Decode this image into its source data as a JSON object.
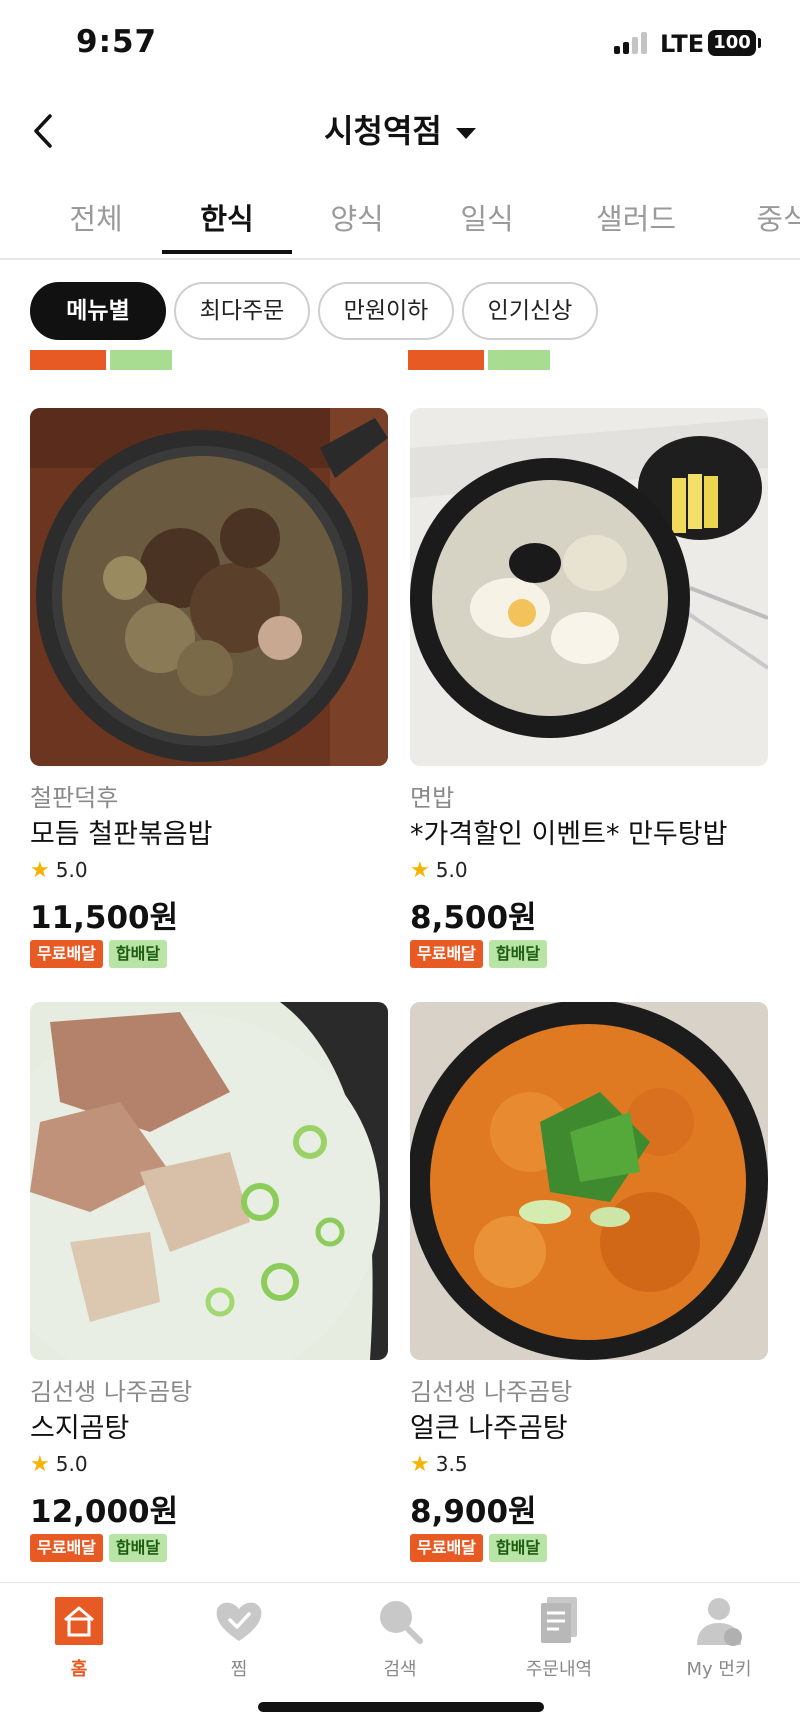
{
  "status_bar": {
    "time": "9:57",
    "network": "LTE",
    "battery": "100"
  },
  "header": {
    "title": "시청역점"
  },
  "tabs": [
    {
      "label": "전체",
      "active": false
    },
    {
      "label": "한식",
      "active": true
    },
    {
      "label": "양식",
      "active": false
    },
    {
      "label": "일식",
      "active": false
    },
    {
      "label": "샐러드",
      "active": false
    },
    {
      "label": "중식",
      "active": false
    }
  ],
  "filters": [
    {
      "label": "메뉴별",
      "active": true
    },
    {
      "label": "최다주문",
      "active": false
    },
    {
      "label": "만원이하",
      "active": false
    },
    {
      "label": "인기신상",
      "active": false
    }
  ],
  "badges": {
    "free_delivery": "무료배달",
    "combined_delivery": "합배달"
  },
  "menu_items": [
    {
      "store": "철판덕후",
      "name": "모듬 철판볶음밥",
      "rating": "5.0",
      "price": "11,500원"
    },
    {
      "store": "면밥",
      "name": "*가격할인 이벤트* 만두탕밥",
      "rating": "5.0",
      "price": "8,500원"
    },
    {
      "store": "김선생 나주곰탕",
      "name": "스지곰탕",
      "rating": "5.0",
      "price": "12,000원"
    },
    {
      "store": "김선생 나주곰탕",
      "name": "얼큰 나주곰탕",
      "rating": "3.5",
      "price": "8,900원"
    }
  ],
  "bottom_nav": [
    {
      "label": "홈",
      "icon": "home-icon",
      "active": true
    },
    {
      "label": "찜",
      "icon": "heart-icon",
      "active": false
    },
    {
      "label": "검색",
      "icon": "search-icon",
      "active": false
    },
    {
      "label": "주문내역",
      "icon": "receipt-icon",
      "active": false
    },
    {
      "label": "My 먼키",
      "icon": "profile-icon",
      "active": false
    }
  ],
  "colors": {
    "accent": "#e85a24",
    "combo_badge": "#b8e4a6",
    "star": "#f5b400"
  }
}
